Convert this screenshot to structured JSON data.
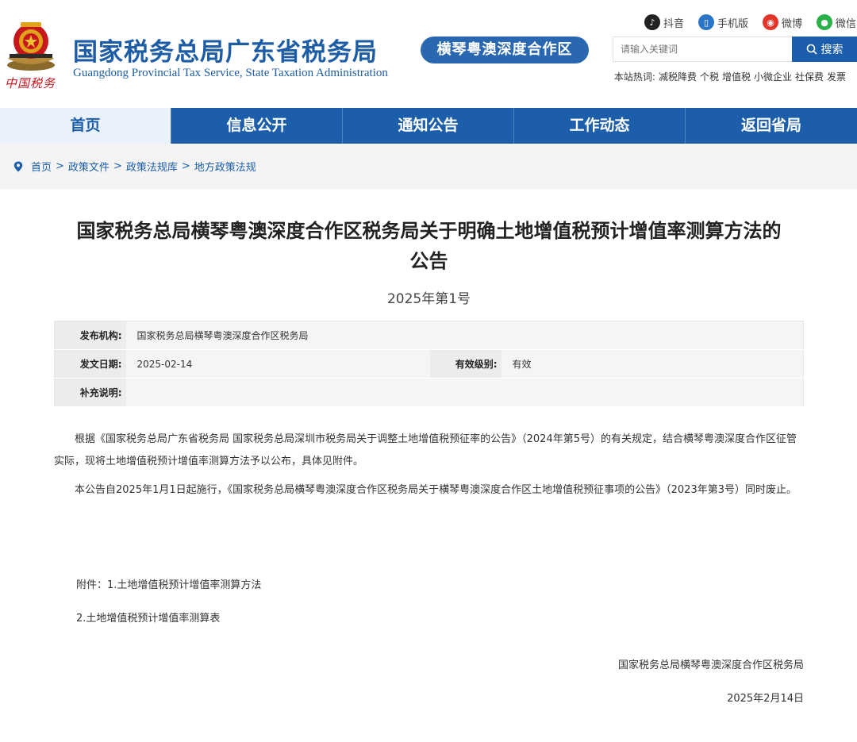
{
  "header": {
    "site_title": "国家税务总局广东省税务局",
    "site_subtitle": "Guangdong Provincial Tax Service, State Taxation Administration",
    "seal_text": "中国税务",
    "region_badge": "横琴粤澳深度合作区",
    "top_links": [
      {
        "label": "抖音",
        "icon": "douyin-icon"
      },
      {
        "label": "手机版",
        "icon": "mobile-icon"
      },
      {
        "label": "微博",
        "icon": "weibo-icon"
      },
      {
        "label": "微信",
        "icon": "wechat-icon"
      }
    ],
    "search": {
      "placeholder": "请输入关键词",
      "button_label": "搜索"
    },
    "hot_words": {
      "label": "本站热词:",
      "words": [
        "减税降费",
        "个税",
        "增值税",
        "小微企业",
        "社保费",
        "发票"
      ]
    }
  },
  "nav": {
    "items": [
      "首页",
      "信息公开",
      "通知公告",
      "工作动态",
      "返回省局"
    ],
    "active_index": 0
  },
  "breadcrumb": [
    "首页",
    "政策文件",
    "政策法规库",
    "地方政策法规"
  ],
  "article": {
    "title_line1": "国家税务总局横琴粤澳深度合作区税务局关于明确土地增值税预计增值率测算方法的",
    "title_line2": "公告",
    "doc_number": "2025年第1号",
    "meta": {
      "publisher_label": "发布机构:",
      "publisher": "国家税务总局横琴粤澳深度合作区税务局",
      "date_label": "发文日期:",
      "date": "2025-02-14",
      "validity_label": "有效级别:",
      "validity": "有效",
      "note_label": "补充说明:",
      "note": ""
    },
    "paragraphs": [
      "根据《国家税务总局广东省税务局 国家税务总局深圳市税务局关于调整土地增值税预征率的公告》（2024年第5号）的有关规定，结合横琴粤澳深度合作区征管实际，现将土地增值税预计增值率测算方法予以公布，具体见附件。",
      "本公告自2025年1月1日起施行，《国家税务总局横琴粤澳深度合作区税务局关于横琴粤澳深度合作区土地增值税预征事项的公告》（2023年第3号）同时废止。"
    ],
    "attachment_1": "附件：1.土地增值税预计增值率测算方法",
    "attachment_2": "2.土地增值税预计增值率测算表",
    "signature": "国家税务总局横琴粤澳深度合作区税务局",
    "sign_date": "2025年2月14日"
  },
  "colors": {
    "brand_blue": "#1c5ea9",
    "badge_blue": "#2a67b1",
    "seal_red": "#c8161d"
  }
}
